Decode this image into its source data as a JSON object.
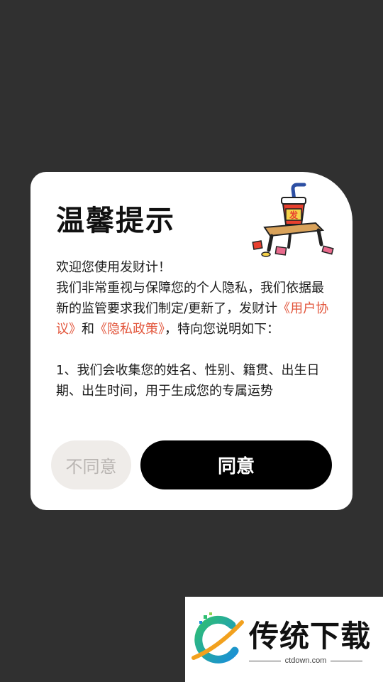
{
  "dialog": {
    "title": "温馨提示",
    "illustration_icon": "fortune-stool-cup-illustration",
    "intro": "欢迎您使用发财计！",
    "paragraph1_part1": "我们非常重视与保障您的个人隐私，我们依据最新的监管要求我们制定/更新了，发财计",
    "user_agreement_link": "《用户协议》",
    "and_text": "和",
    "privacy_policy_link": "《隐私政策》",
    "paragraph1_part2": "，特向您说明如下：",
    "paragraph2": "1、我们会收集您的姓名、性别、籍贯、出生日期、出生时间，用于生成您的专属运势",
    "disagree_label": "不同意",
    "agree_label": "同意"
  },
  "watermark": {
    "logo_icon": "ctdown-logo-icon",
    "name": "传统下载",
    "domain": "ctdown.com"
  },
  "colors": {
    "background": "#303030",
    "dialog": "#ffffff",
    "link": "#e2553b",
    "agree_button": "#000000",
    "disagree_button": "#efece9"
  }
}
